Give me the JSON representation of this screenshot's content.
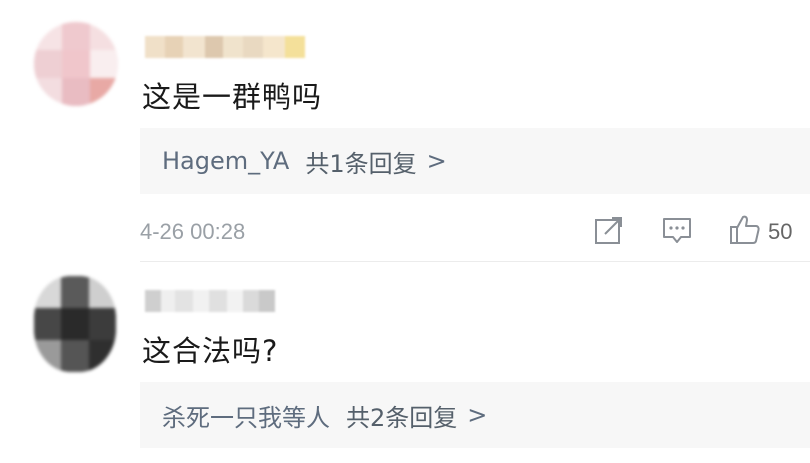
{
  "comments": [
    {
      "text": "这是一群鸭吗",
      "reply": {
        "author": "Hagem_YA",
        "count_label": "共1条回复",
        "chevron": ">"
      },
      "timestamp": "4-26 00:28",
      "likes": "50",
      "icons": {
        "share": "share-icon",
        "comment": "comment-icon",
        "like": "thumbs-up-icon"
      }
    },
    {
      "text": "这合法吗?",
      "reply": {
        "author": "杀死一只我等人",
        "count_label": "共2条回复",
        "chevron": ">"
      }
    }
  ],
  "colors": {
    "reply_author": "#5e6c7e",
    "meta_gray": "#9aa0a6",
    "reply_bg": "#f7f7f7"
  }
}
